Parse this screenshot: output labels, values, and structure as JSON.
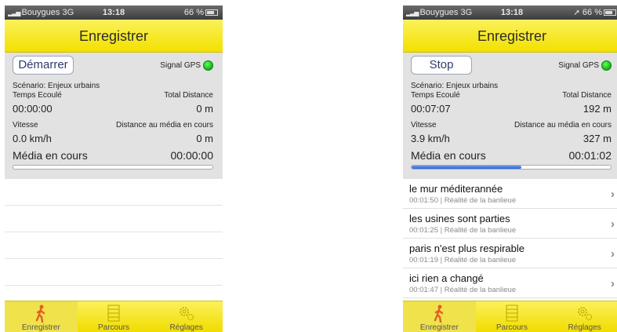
{
  "left": {
    "status": {
      "carrier": "Bouygues 3G",
      "time": "13:18",
      "battery": "66 %"
    },
    "title": "Enregistrer",
    "button": "Démarrer",
    "gps_label": "Signal GPS",
    "scenario": "Scénario: Enjeux urbains",
    "time_label": "Temps Ecoulé",
    "distance_label": "Total Distance",
    "time_value": "00:00:00",
    "distance_value": "0 m",
    "speed_label": "Vitesse",
    "media_distance_label": "Distance au média en cours",
    "speed_value": "0.0 km/h",
    "media_distance_value": "0 m",
    "media_label": "Média en cours",
    "media_time": "00:00:00",
    "progress": 0
  },
  "right": {
    "status": {
      "carrier": "Bouygues 3G",
      "time": "13:18",
      "battery": "66 %"
    },
    "title": "Enregistrer",
    "button": "Stop",
    "gps_label": "Signal GPS",
    "scenario": "Scénario: Enjeux urbains",
    "time_label": "Temps Ecoulé",
    "distance_label": "Total Distance",
    "time_value": "00:07:07",
    "distance_value": "192 m",
    "speed_label": "Vitesse",
    "media_distance_label": "Distance au média en cours",
    "speed_value": "3.9 km/h",
    "media_distance_value": "327 m",
    "media_label": "Média en cours",
    "media_time": "00:01:02",
    "progress": 0.55,
    "items": [
      {
        "title": "le mur méditerannée",
        "subtitle": "00:01:50 | Réalité de la banlieue"
      },
      {
        "title": "les usines sont parties",
        "subtitle": "00:01:25 | Réalité de la banlieue"
      },
      {
        "title": "paris n'est plus respirable",
        "subtitle": "00:01:19 | Réalité de la banlieue"
      },
      {
        "title": "ici rien a changé",
        "subtitle": "00:01:47 | Réalité de la banlieue"
      }
    ]
  },
  "tabs": [
    "Enregistrer",
    "Parcours",
    "Réglages"
  ],
  "icons": {
    "tab1": "walking-person-icon",
    "tab2": "list-icon",
    "tab3": "gear-icon"
  },
  "colors": {
    "accent": "#f3e000",
    "gps": "#18b018",
    "progress": "#2c62d4"
  }
}
